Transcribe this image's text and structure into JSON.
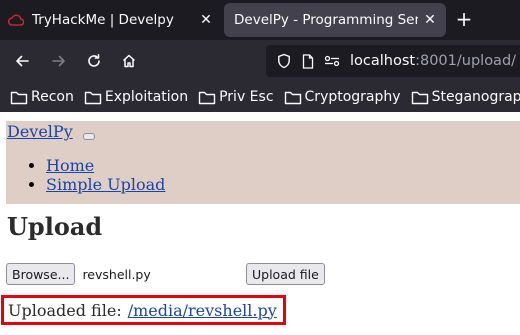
{
  "browser": {
    "tabs": [
      {
        "title": "TryHackMe | Develpy",
        "active": false,
        "favicon": "tryhackme-logo-icon"
      },
      {
        "title": "DevelPy - Programming Servi",
        "active": true
      }
    ],
    "new_tab_label": "+",
    "close_glyph": "✕",
    "url": {
      "host": "localhost",
      "rest": ":8001/upload/"
    },
    "bookmarks": [
      "Recon",
      "Exploitation",
      "Priv Esc",
      "Cryptography",
      "Steganography"
    ]
  },
  "page": {
    "brand": "DevelPy",
    "nav_links": [
      "Home",
      "Simple Upload"
    ],
    "heading": "Upload",
    "browse_label": "Browse...",
    "selected_file": "revshell.py",
    "upload_label": "Upload file",
    "result_label": "Uploaded file:",
    "result_link": "/media/revshell.py"
  },
  "colors": {
    "tab_bar": "#1c1b22",
    "toolbar": "#2b2a33",
    "nav_background": "#dfcec6",
    "link": "#1a45a8",
    "highlight_border": "#e8000b"
  }
}
